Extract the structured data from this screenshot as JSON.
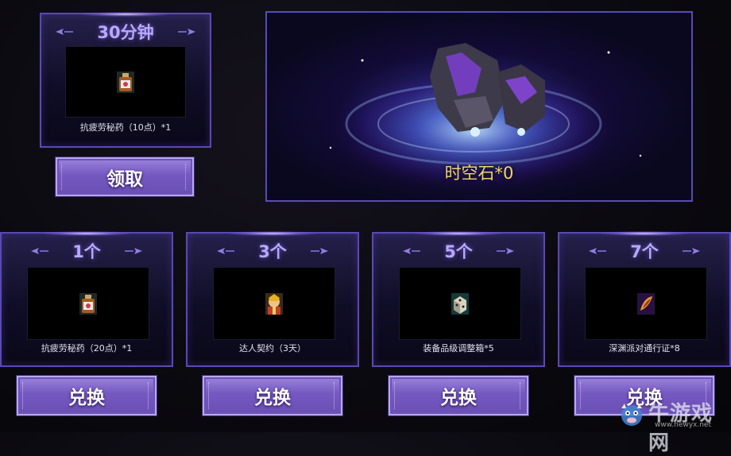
{
  "top_reward": {
    "title": "30分钟",
    "item_name": "抗疲劳秘药（10点）*1",
    "item_icon": "potion-bottle-icon",
    "button_label": "领取"
  },
  "stone": {
    "label": "时空石*0",
    "image": "space-time-stone-icon"
  },
  "exchange_rewards": [
    {
      "title": "1个",
      "item_name": "抗疲劳秘药（20点）*1",
      "item_icon": "potion-bottle-icon",
      "button_label": "兑换"
    },
    {
      "title": "3个",
      "item_name": "达人契约（3天）",
      "item_icon": "expert-contract-icon",
      "button_label": "兑换"
    },
    {
      "title": "5个",
      "item_name": "装备品级调整箱*5",
      "item_icon": "equipment-box-icon",
      "button_label": "兑换"
    },
    {
      "title": "7个",
      "item_name": "深渊派对通行证*8",
      "item_icon": "abyss-pass-icon",
      "button_label": "兑换"
    }
  ],
  "watermark": {
    "text": "牛游戏网",
    "url": "www.newyx.net"
  },
  "colors": {
    "accent": "#b7a8ff",
    "button": "#7558c0",
    "stone_label": "#f1d56b",
    "border": "#5b48b5"
  }
}
